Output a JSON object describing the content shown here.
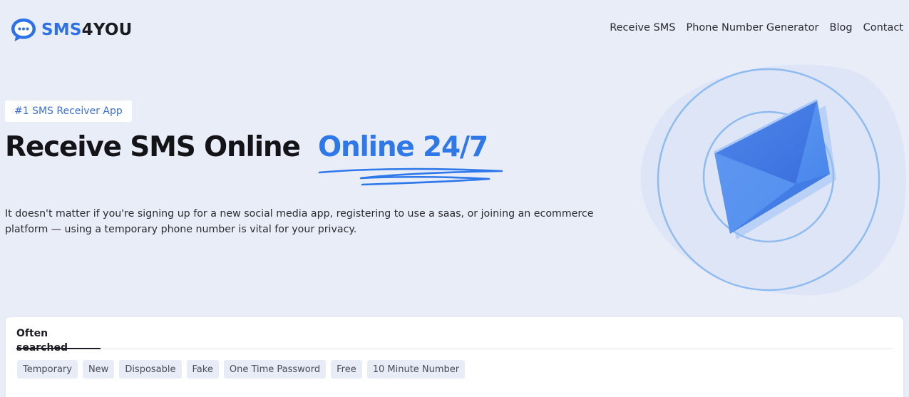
{
  "brand": {
    "name_prefix": "SMS",
    "name_suffix": "4YOU",
    "accent_color": "#2d72e8"
  },
  "nav": {
    "items": [
      {
        "label": "Receive SMS"
      },
      {
        "label": "Phone Number Generator"
      },
      {
        "label": "Blog"
      },
      {
        "label": "Contact"
      }
    ]
  },
  "hero": {
    "badge": "#1 SMS Receiver App",
    "headline": "Receive SMS Online",
    "headline_accent": "Online 24/7",
    "description": "It doesn't matter if you're signing up for a new social media app, registering to use a saas, or joining an ecommerce platform — using a temporary phone number is vital for your privacy.",
    "illustration_icon": "envelope-icon"
  },
  "search_panel": {
    "tab_label": "Often searched",
    "tags": [
      "Temporary",
      "New",
      "Disposable",
      "Fake",
      "One Time Password",
      "Free",
      "10 Minute Number"
    ]
  }
}
